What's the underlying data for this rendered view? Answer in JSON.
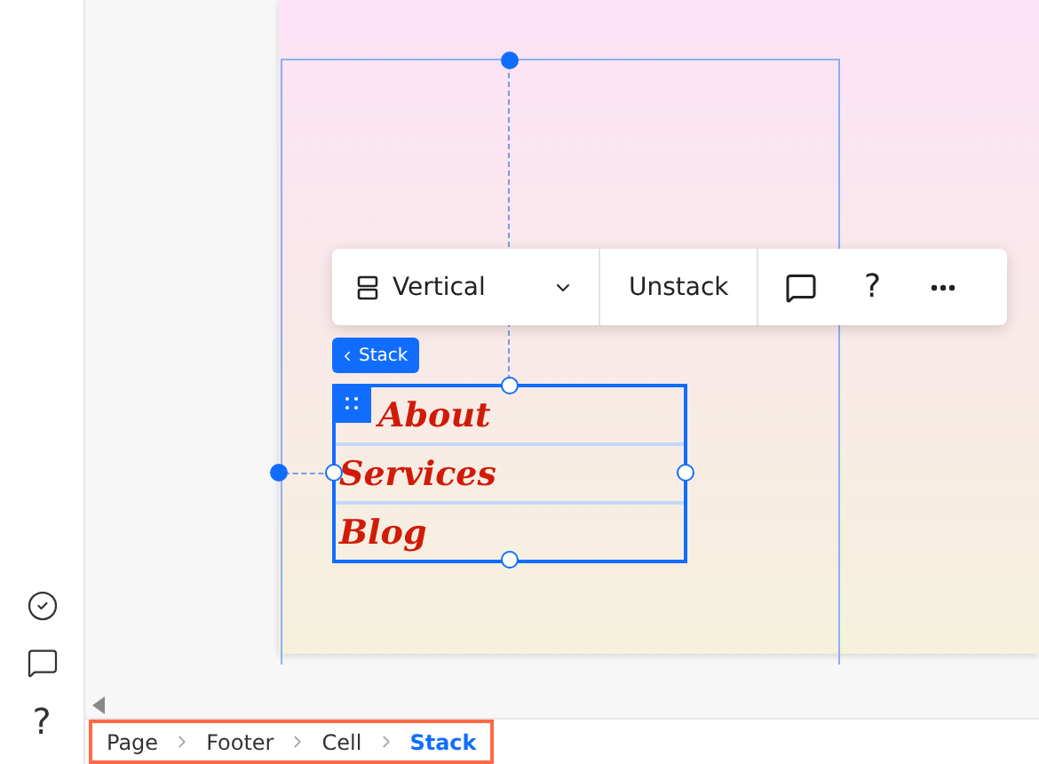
{
  "sidebar": {
    "help": "?"
  },
  "toolbar": {
    "layout_label": "Vertical",
    "unstack_label": "Unstack",
    "help": "?"
  },
  "stack_tag": {
    "label": "Stack"
  },
  "stack_items": [
    {
      "label": "About"
    },
    {
      "label": "Services"
    },
    {
      "label": "Blog"
    }
  ],
  "breadcrumb": [
    {
      "label": "Page",
      "selected": false
    },
    {
      "label": "Footer",
      "selected": false
    },
    {
      "label": "Cell",
      "selected": false
    },
    {
      "label": "Stack",
      "selected": true
    }
  ]
}
